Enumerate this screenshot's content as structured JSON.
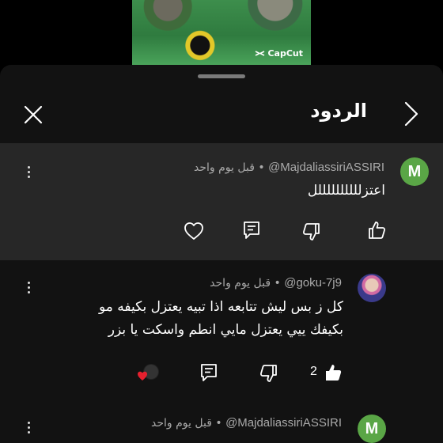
{
  "video": {
    "watermark": "CapCut"
  },
  "panel": {
    "title": "الردود"
  },
  "comments": [
    {
      "avatar_letter": "M",
      "handle": "@MajdaliassiriASSIRI",
      "time": "قبل يوم واحد",
      "text": "اعتزللللللللللل",
      "likes": ""
    },
    {
      "avatar_letter": "",
      "handle": "@goku-7j9",
      "time": "قبل يوم واحد",
      "text_line1": "كل ز بس ليش تتابعه اذا تبيه يعتزل بكيفه مو",
      "text_line2": "بكيفك ييي يعتزل مايي انطم واسكت يا بزر",
      "likes": "2"
    },
    {
      "avatar_letter": "M",
      "handle": "@MajdaliassiriASSIRI",
      "time": "قبل يوم واحد"
    }
  ],
  "separator": "•",
  "colors": {
    "highlight_bg": "#272727",
    "sheet_bg": "#121212",
    "avatar_green": "#5aa646",
    "heart_red": "#e5202e"
  }
}
